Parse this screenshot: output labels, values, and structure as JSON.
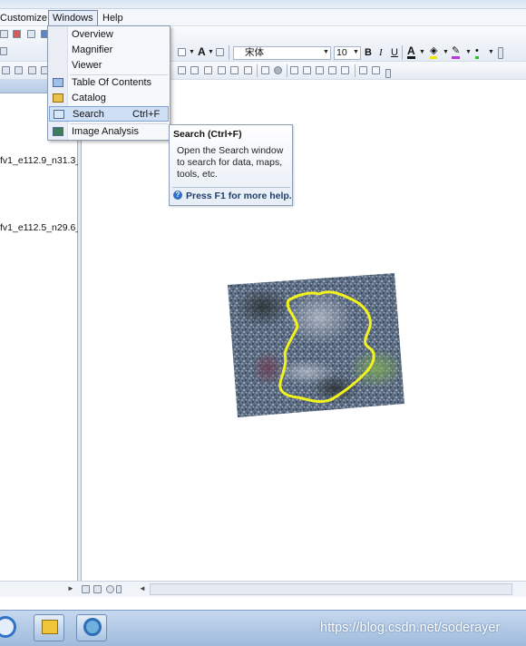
{
  "menubar": {
    "items": [
      "Customize",
      "Windows",
      "Help"
    ]
  },
  "windows_menu": {
    "items": [
      {
        "label": "Overview",
        "shortcut": "",
        "icon": ""
      },
      {
        "label": "Magnifier",
        "shortcut": "",
        "icon": ""
      },
      {
        "label": "Viewer",
        "shortcut": "",
        "icon": ""
      },
      {
        "label": "Table Of Contents",
        "shortcut": "",
        "icon": "table-of-contents-icon"
      },
      {
        "label": "Catalog",
        "shortcut": "",
        "icon": "catalog-icon"
      },
      {
        "label": "Search",
        "shortcut": "Ctrl+F",
        "icon": "search-window-icon",
        "highlighted": true
      },
      {
        "label": "Image Analysis",
        "shortcut": "",
        "icon": "image-analysis-icon"
      }
    ]
  },
  "tooltip": {
    "title": "Search (Ctrl+F)",
    "body": "Open the Search window to search for data, maps, tools, etc.",
    "help": "Press F1 for more help."
  },
  "toolbar": {
    "font_name": "宋体",
    "font_size": "10",
    "bold": "B",
    "italic": "I",
    "underline": "U",
    "text_button": "A"
  },
  "toc": {
    "layers": [
      "fv1_e112.9_n31.3_",
      "fv1_e112.5_n29.6_"
    ]
  },
  "watermark": "https://blog.csdn.net/soderayer",
  "colors": {
    "boundary": "#f2f21c",
    "menu_highlight": "#cfe0f6",
    "taskbar": "#a9c3e2"
  }
}
